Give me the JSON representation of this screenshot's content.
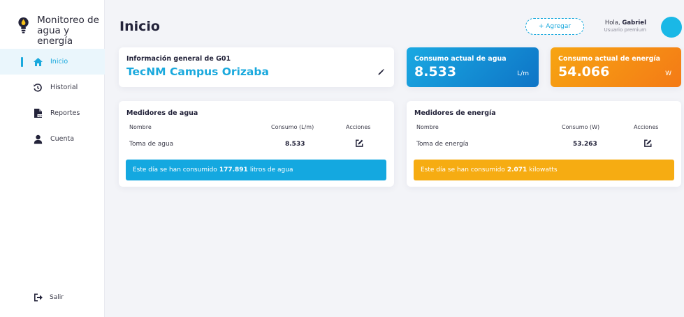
{
  "brand": {
    "line1": "Monitoreo de",
    "line2": "agua y energía"
  },
  "nav": {
    "items": [
      {
        "label": "Inicio",
        "icon": "home-icon",
        "active": true
      },
      {
        "label": "Historial",
        "icon": "history-icon",
        "active": false
      },
      {
        "label": "Reportes",
        "icon": "pdf-report-icon",
        "active": false
      },
      {
        "label": "Cuenta",
        "icon": "user-icon",
        "active": false
      }
    ],
    "logout": {
      "label": "Salir",
      "icon": "logout-icon"
    }
  },
  "header": {
    "title": "Inicio",
    "add_label": "+ Agregar",
    "greeting_prefix": "Hola, ",
    "user_name": "Gabriel",
    "user_role": "Usuario premium"
  },
  "info": {
    "label": "Información general de G01",
    "value": "TecNM Campus Orizaba"
  },
  "water_stat": {
    "label": "Consumo actual de agua",
    "value": "8.533",
    "unit": "L/m"
  },
  "energy_stat": {
    "label": "Consumo actual de energía",
    "value": "54.066",
    "unit": "W"
  },
  "water_meters": {
    "title": "Medidores de agua",
    "columns": [
      "Nombre",
      "Consumo (L/m)",
      "Acciones"
    ],
    "rows": [
      {
        "name": "Toma de agua",
        "consumption": "8.533"
      }
    ],
    "banner_prefix": "Este día se han consumido",
    "banner_value": "177.891",
    "banner_suffix": "litros de agua"
  },
  "energy_meters": {
    "title": "Medidores de energía",
    "columns": [
      "Nombre",
      "Consumo (W)",
      "Acciones"
    ],
    "rows": [
      {
        "name": "Toma de energía",
        "consumption": "53.263"
      }
    ],
    "banner_prefix": "Este día se han consumido",
    "banner_value": "2.071",
    "banner_suffix": "kilowatts"
  },
  "colors": {
    "accent": "#1aa9dd",
    "water_gradient_start": "#1aa9e2",
    "water_gradient_end": "#0e74c6",
    "energy_gradient_start": "#f7a512",
    "energy_gradient_end": "#f47a16",
    "water_banner": "#14a8e0",
    "energy_banner": "#f6ac12"
  }
}
